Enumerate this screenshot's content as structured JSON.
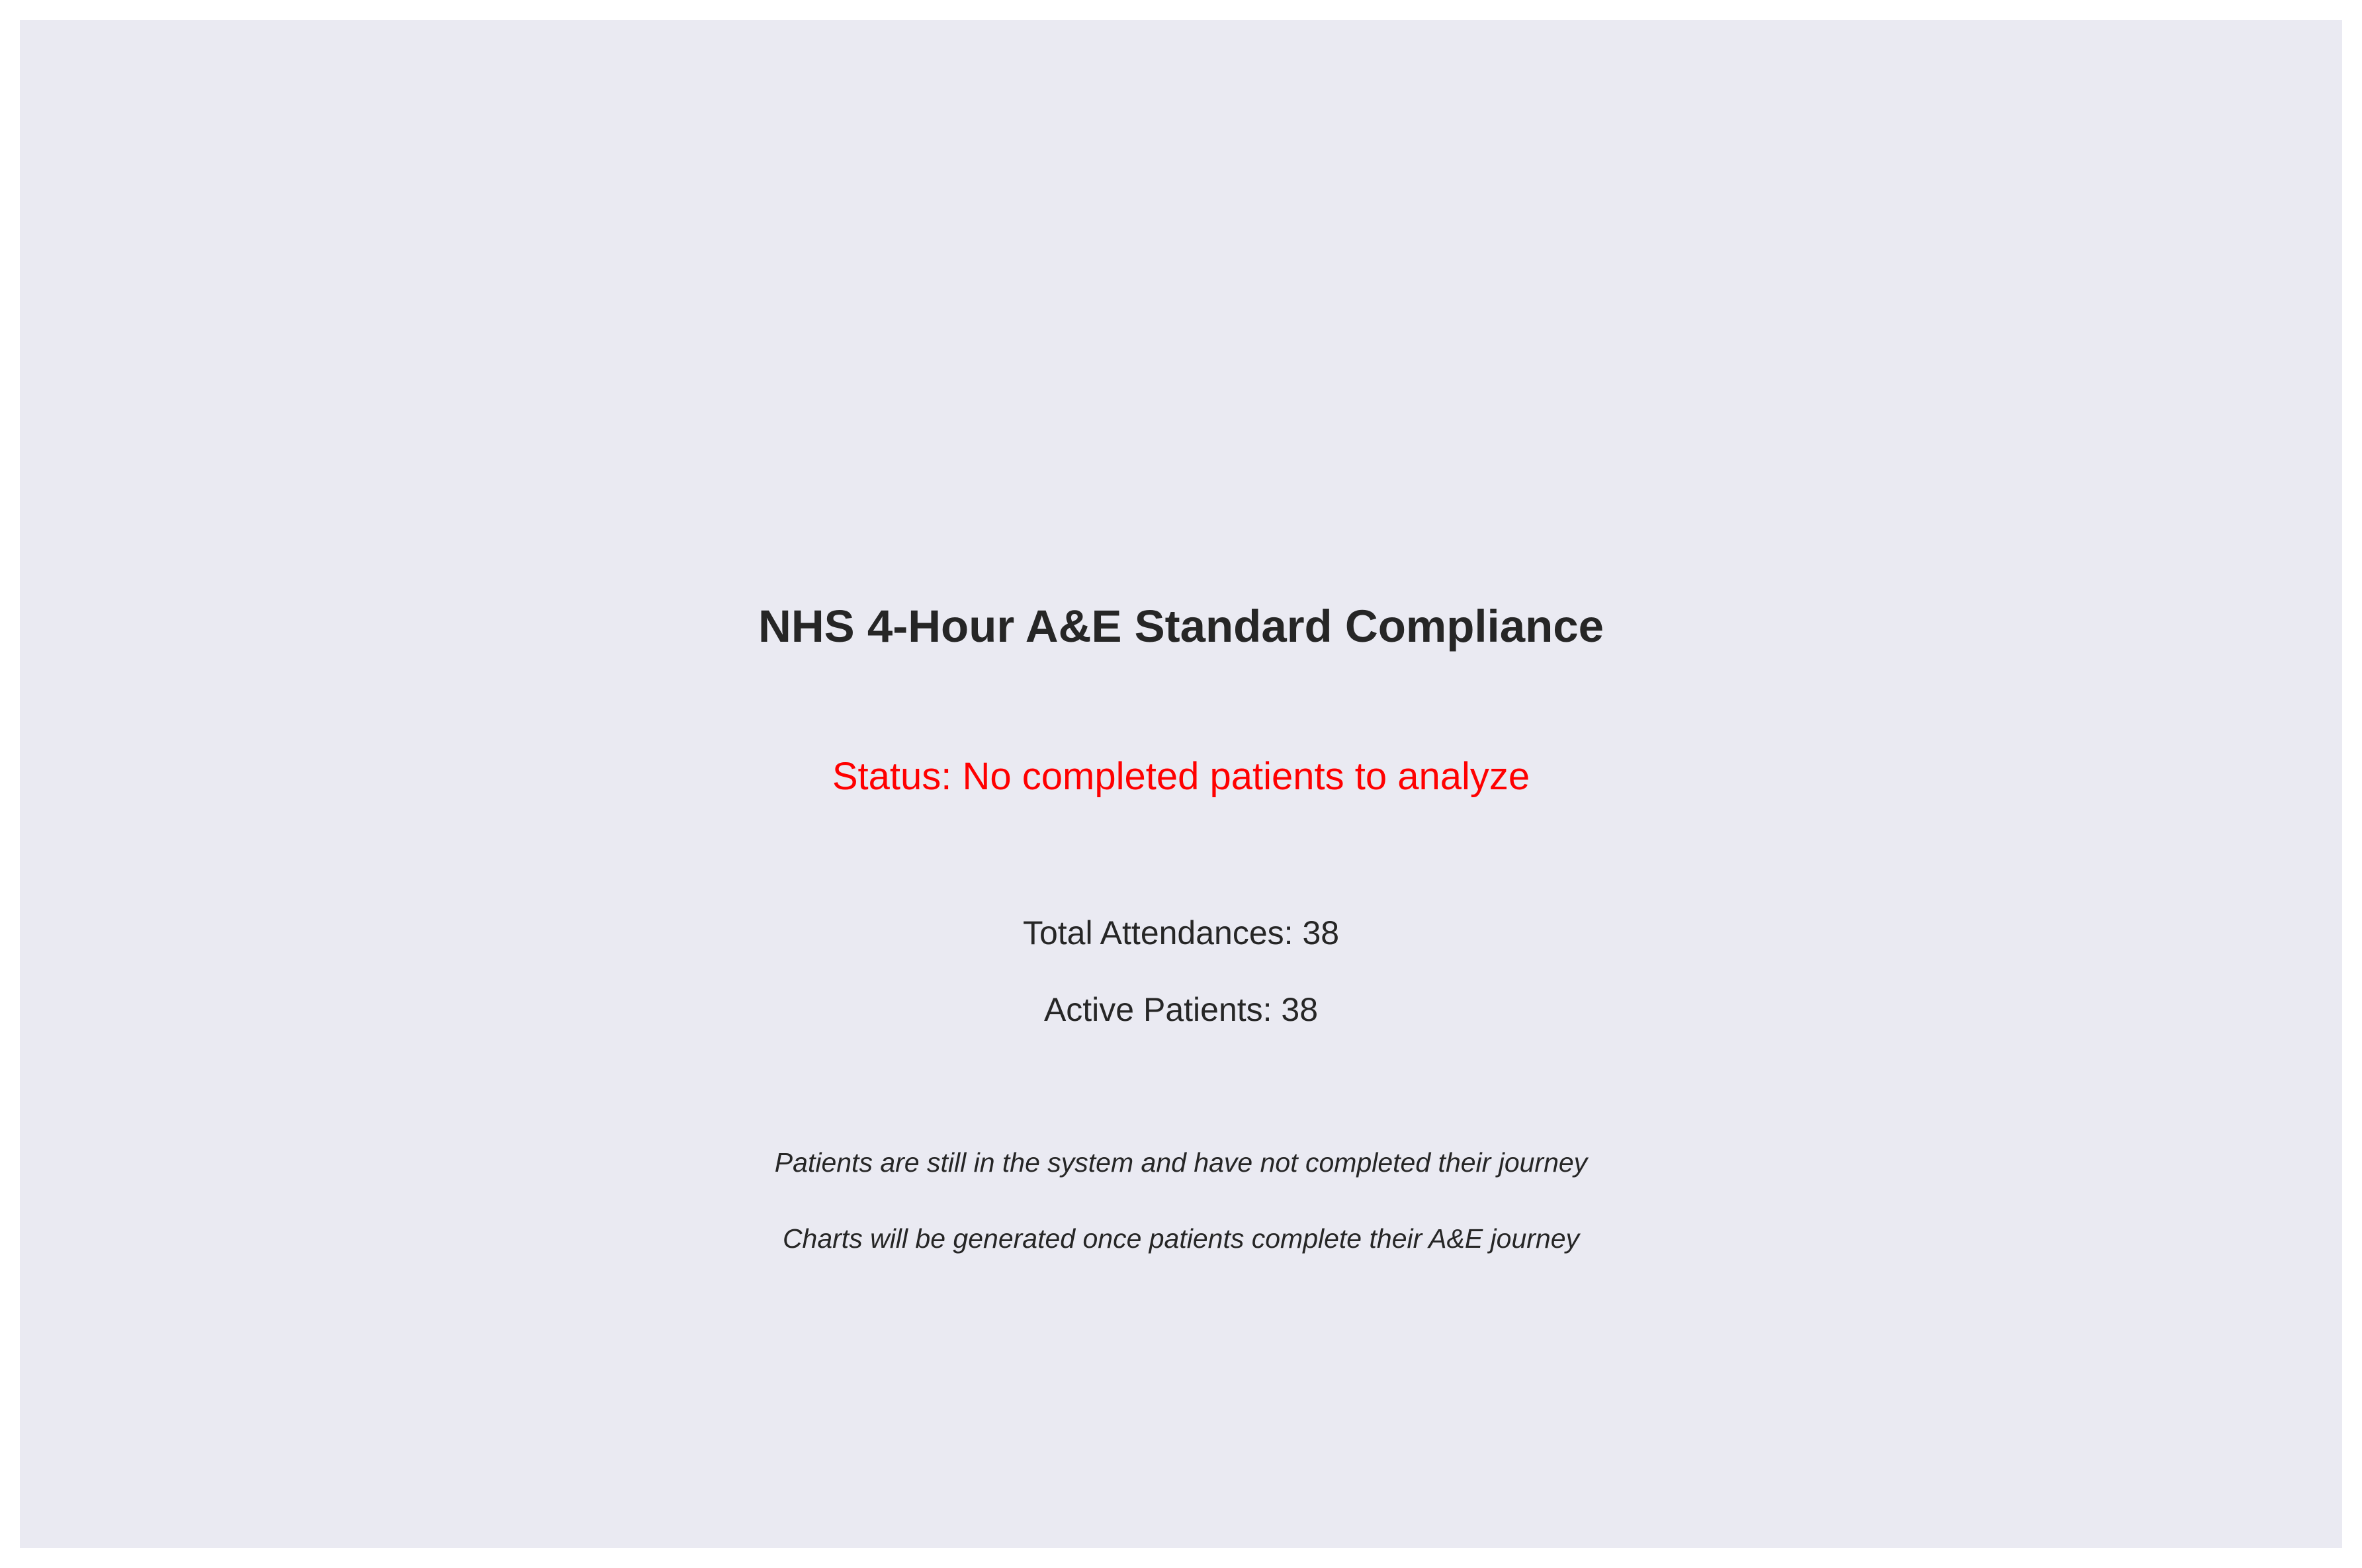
{
  "colors": {
    "background": "#eaeaf2",
    "text": "#262626",
    "status": "#ff0000"
  },
  "chart_data": {
    "type": "text",
    "title": "NHS 4-Hour A&E Standard Compliance",
    "status": "Status: No completed patients to analyze",
    "total_attendances": "Total Attendances: 38",
    "active_patients": "Active Patients: 38",
    "notes": [
      "Patients are still in the system and have not completed their journey",
      "Charts will be generated once patients complete their A&E journey"
    ]
  }
}
